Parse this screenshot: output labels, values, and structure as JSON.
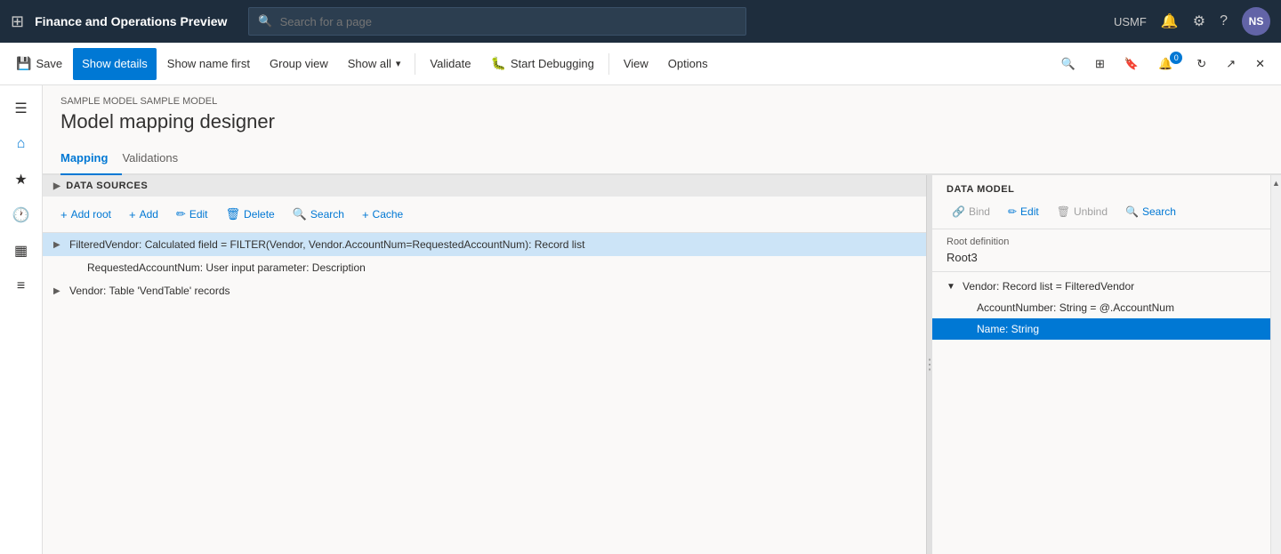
{
  "app": {
    "grid_icon": "⊞",
    "title": "Finance and Operations Preview",
    "search_placeholder": "Search for a page",
    "nav_right": {
      "env_label": "USMF",
      "bell_icon": "🔔",
      "gear_icon": "⚙",
      "help_icon": "?",
      "avatar_label": "NS"
    }
  },
  "toolbar": {
    "save_label": "Save",
    "show_details_label": "Show details",
    "show_name_first_label": "Show name first",
    "group_view_label": "Group view",
    "show_all_label": "Show all",
    "validate_label": "Validate",
    "start_debugging_label": "Start Debugging",
    "view_label": "View",
    "options_label": "Options"
  },
  "sidebar": {
    "items": [
      {
        "icon": "☰",
        "name": "hamburger-menu"
      },
      {
        "icon": "⌂",
        "name": "home"
      },
      {
        "icon": "★",
        "name": "favorites"
      },
      {
        "icon": "🕐",
        "name": "recent"
      },
      {
        "icon": "▦",
        "name": "workspaces"
      },
      {
        "icon": "≡",
        "name": "modules"
      }
    ]
  },
  "page": {
    "breadcrumb": "SAMPLE MODEL SAMPLE MODEL",
    "title": "Model mapping designer"
  },
  "tabs": [
    {
      "label": "Mapping",
      "active": true
    },
    {
      "label": "Validations",
      "active": false
    }
  ],
  "data_sources_panel": {
    "header": "DATA SOURCES",
    "toolbar_buttons": [
      {
        "label": "Add root",
        "icon": "+"
      },
      {
        "label": "Add",
        "icon": "+"
      },
      {
        "label": "Edit",
        "icon": "✏"
      },
      {
        "label": "Delete",
        "icon": "🗑"
      },
      {
        "label": "Search",
        "icon": "🔍"
      },
      {
        "label": "Cache",
        "icon": "+"
      }
    ],
    "tree_items": [
      {
        "id": "filtered-vendor",
        "indent": 0,
        "expand": "▶",
        "selected": true,
        "text": "FilteredVendor: Calculated field = FILTER(Vendor, Vendor.AccountNum=RequestedAccountNum): Record list"
      },
      {
        "id": "requested-account-num",
        "indent": 1,
        "expand": "",
        "selected": false,
        "text": "RequestedAccountNum: User input parameter: Description"
      },
      {
        "id": "vendor-table",
        "indent": 0,
        "expand": "▶",
        "selected": false,
        "text": "Vendor: Table 'VendTable' records"
      }
    ]
  },
  "data_model_panel": {
    "title": "DATA MODEL",
    "toolbar_buttons": [
      {
        "label": "Bind",
        "icon": "🔗",
        "disabled": true
      },
      {
        "label": "Edit",
        "icon": "✏",
        "disabled": false
      },
      {
        "label": "Unbind",
        "icon": "🗑",
        "disabled": true
      },
      {
        "label": "Search",
        "icon": "🔍",
        "disabled": false
      }
    ],
    "root_definition_label": "Root definition",
    "root_definition_value": "Root3",
    "tree_items": [
      {
        "id": "vendor-record-list",
        "indent": 0,
        "expand": "▼",
        "selected": false,
        "text": "Vendor: Record list = FilteredVendor"
      },
      {
        "id": "account-number",
        "indent": 1,
        "expand": "",
        "selected": false,
        "text": "AccountNumber: String = @.AccountNum"
      },
      {
        "id": "name-string",
        "indent": 1,
        "expand": "",
        "selected": true,
        "text": "Name: String"
      }
    ]
  }
}
